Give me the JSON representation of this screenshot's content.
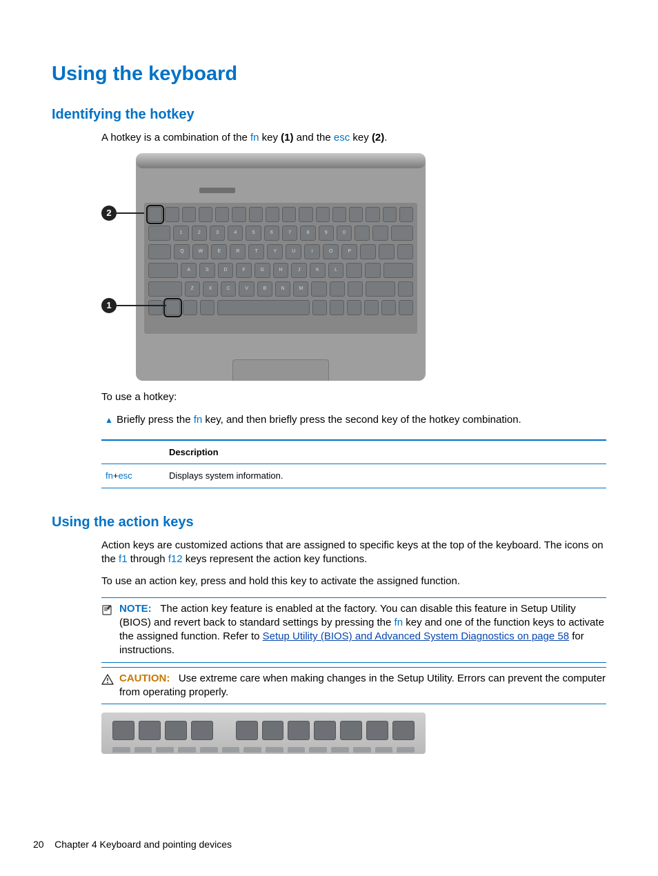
{
  "headings": {
    "h1": "Using the keyboard",
    "h2_identifying": "Identifying the hotkey",
    "h2_action": "Using the action keys"
  },
  "intro": {
    "prefix": "A hotkey is a combination of the ",
    "fn": "fn",
    "mid1": " key ",
    "bold1": "(1)",
    "mid2": " and the ",
    "esc": "esc",
    "mid3": " key ",
    "bold2": "(2)",
    "suffix": "."
  },
  "to_use_label": "To use a hotkey:",
  "step": {
    "prefix": "Briefly press the ",
    "fn": "fn",
    "suffix": " key, and then briefly press the second key of the hotkey combination."
  },
  "table": {
    "header_desc": "Description",
    "row_key_fn": "fn",
    "row_key_plus": "+",
    "row_key_esc": "esc",
    "row_desc": "Displays system information."
  },
  "action": {
    "p1a": "Action keys are customized actions that are assigned to specific keys at the top of the keyboard. The icons on the ",
    "f1": "f1",
    "p1b": " through ",
    "f12": "f12",
    "p1c": " keys represent the action key functions.",
    "p2": "To use an action key, press and hold this key to activate the assigned function."
  },
  "note": {
    "label": "NOTE:",
    "t1": "The action key feature is enabled at the factory. You can disable this feature in Setup Utility (BIOS) and revert back to standard settings by pressing the ",
    "fn": "fn",
    "t2": " key and one of the function keys to activate the assigned function. Refer to ",
    "link": "Setup Utility (BIOS) and Advanced System Diagnostics on page 58",
    "t3": " for instructions."
  },
  "caution": {
    "label": "CAUTION:",
    "text": "Use extreme care when making changes in the Setup Utility. Errors can prevent the computer from operating properly."
  },
  "footer": {
    "page": "20",
    "chapter": "Chapter 4   Keyboard and pointing devices"
  },
  "callouts": {
    "c1": "1",
    "c2": "2"
  },
  "step_marker": "▲"
}
